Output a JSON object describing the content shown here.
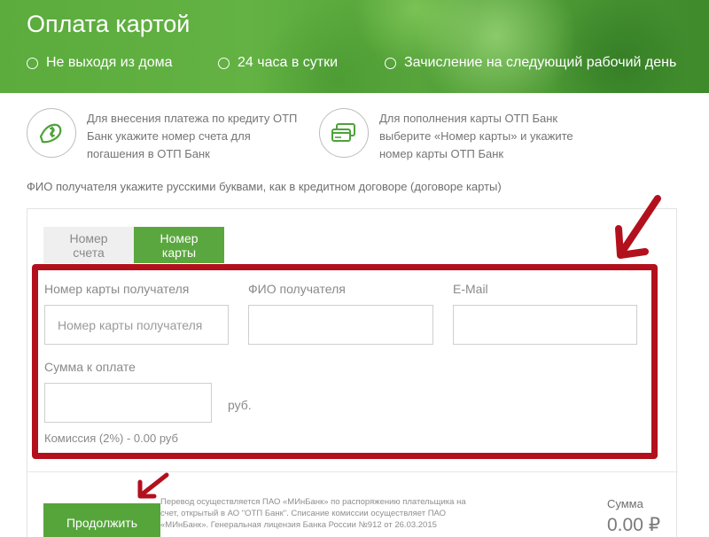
{
  "header": {
    "title": "Оплата картой",
    "features": [
      "Не выходя из дома",
      "24 часа в сутки",
      "Зачисление на следующий рабочий день"
    ]
  },
  "info": {
    "credit": "Для внесения платежа по кредиту ОТП Банк укажите номер счета для погашения в ОТП Банк",
    "card": "Для пополнения карты ОТП Банк выберите «Номер карты» и укажите номер карты ОТП Банк"
  },
  "note": "ФИО получателя укажите русскими буквами, как в кредитном договоре (договоре карты)",
  "tabs": {
    "account": "Номер счета",
    "card": "Номер карты",
    "active": "card"
  },
  "form": {
    "card_label": "Номер карты получателя",
    "card_placeholder": "Номер карты получателя",
    "card_value": "",
    "name_label": "ФИО получателя",
    "name_value": "",
    "email_label": "E-Mail",
    "email_value": "",
    "amount_label": "Сумма к оплате",
    "amount_value": "",
    "currency": "руб.",
    "commission": "Комиссия (2%) - 0.00 руб"
  },
  "footer": {
    "continue_label": "Продолжить",
    "legal": "Перевод осуществляется ПАО «МИнБанк» по распоряжению плательщика на счет, открытый в АО \"ОТП Банк\". Списание комиссии осуществляет ПАО «МИнБанк». Генеральная лицензия Банка России №912 от 26.03.2015",
    "sum_label": "Сумма",
    "sum_value": "0.00 ₽"
  },
  "colors": {
    "brand_green": "#5aa73f",
    "annotation_red": "#b3101e"
  },
  "icons": {
    "credit": "hand-coin-icon",
    "card": "cards-icon",
    "feature_bullet": "circle-bullet-icon",
    "annotation": "red-arrow-icon"
  }
}
